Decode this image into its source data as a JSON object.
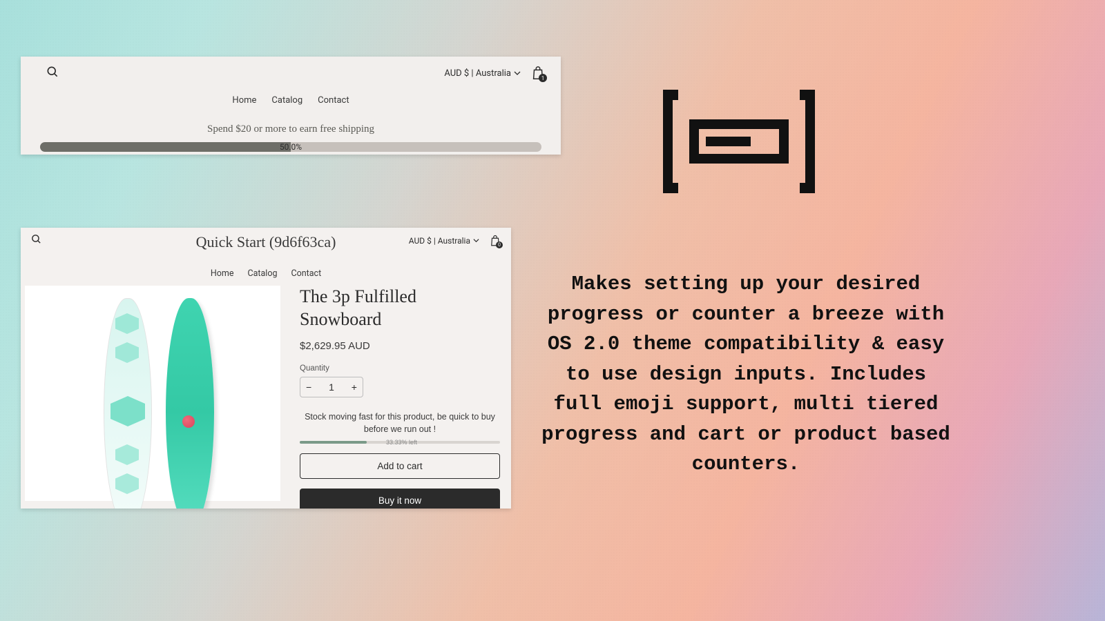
{
  "screenshot_top": {
    "currency_label": "AUD $ | Australia",
    "cart_count": "1",
    "nav": [
      "Home",
      "Catalog",
      "Contact"
    ],
    "banner_text": "Spend $20 or more to earn free shipping",
    "progress_label": "50.0%"
  },
  "screenshot_bottom": {
    "site_title": "Quick Start (9d6f63ca)",
    "currency_label": "AUD $ | Australia",
    "cart_count": "0",
    "nav": [
      "Home",
      "Catalog",
      "Contact"
    ],
    "product_title": "The 3p Fulfilled Snowboard",
    "price": "$2,629.95 AUD",
    "quantity_label": "Quantity",
    "quantity_value": "1",
    "minus": "−",
    "plus": "+",
    "stock_message": "Stock moving fast for this product, be quick to buy before we run out !",
    "stock_bar_text": "33.33% left",
    "add_to_cart": "Add to cart",
    "buy_now": "Buy it now"
  },
  "marketing_copy": "Makes setting up your desired progress or counter a breeze with OS 2.0 theme compatibility & easy to use design inputs. Includes full emoji support, multi tiered progress and cart or product based counters."
}
